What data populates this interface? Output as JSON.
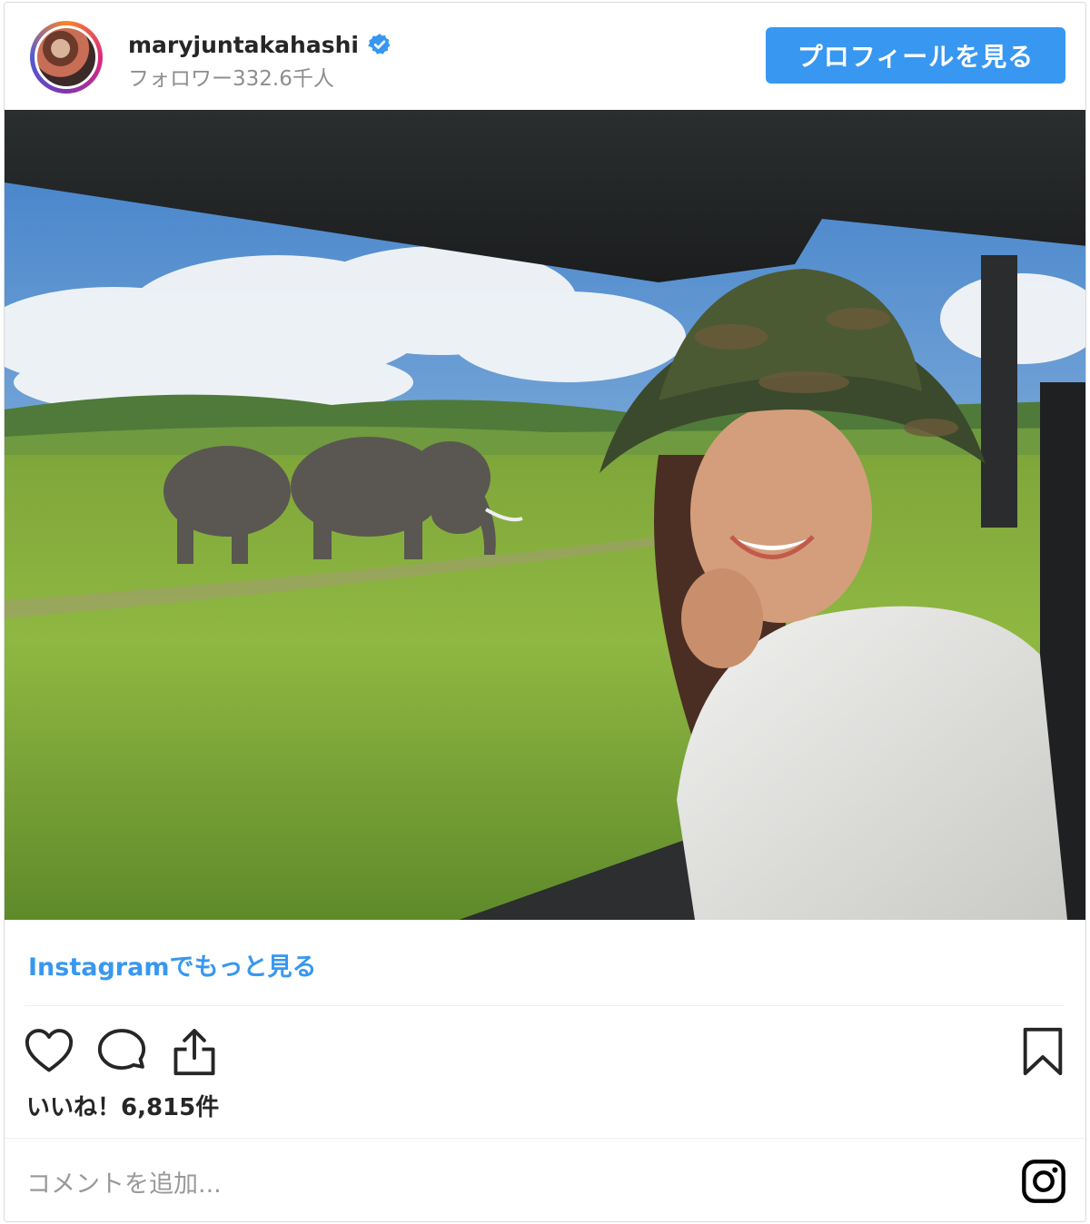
{
  "header": {
    "username": "maryjuntakahashi",
    "followers": "フォロワー332.6千人",
    "profile_button": "プロフィールを見る"
  },
  "post": {
    "more_link": "Instagramでもっと見る",
    "likes": "いいね！6,815件",
    "comment_placeholder": "コメントを追加..."
  },
  "colors": {
    "accent": "#3897f0",
    "text": "#262626",
    "muted": "#8e8e8e"
  },
  "icons": [
    "heart-icon",
    "comment-icon",
    "share-icon",
    "bookmark-icon",
    "instagram-logo-icon",
    "verified-badge-icon"
  ]
}
